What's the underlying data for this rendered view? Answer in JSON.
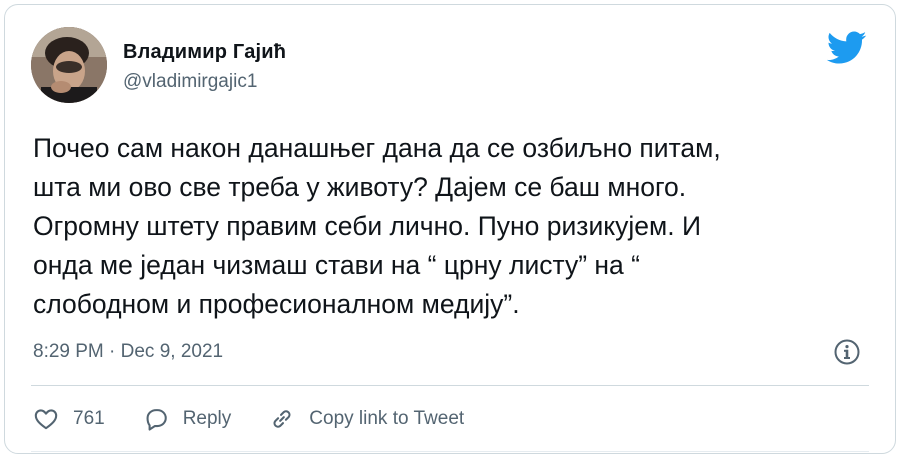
{
  "author": {
    "name": "Владимир Гајић",
    "handle": "@vladimirgajic1"
  },
  "tweet": {
    "lines": [
      "Почео сам након данашњег дана да се озбиљно питам,",
      "шта ми ово све треба у животу? Дајем се баш много.",
      "Огромну штету правим себи лично. Пуно ризикујем. И",
      "онда ме један чизмаш стави на “ црну листу” на “",
      "слободном и професионалном медију”."
    ],
    "timestamp": "8:29 PM · Dec 9, 2021"
  },
  "actions": {
    "like_count": "761",
    "reply_label": "Reply",
    "copy_link_label": "Copy link to Tweet"
  },
  "colors": {
    "brand": "#1d9bf0",
    "secondary_text": "#536471",
    "border": "#cfd9de"
  },
  "icons": {
    "logo": "twitter-bird-icon",
    "info": "info-icon",
    "like": "heart-icon",
    "reply": "reply-bubble-icon",
    "copy": "link-icon"
  }
}
